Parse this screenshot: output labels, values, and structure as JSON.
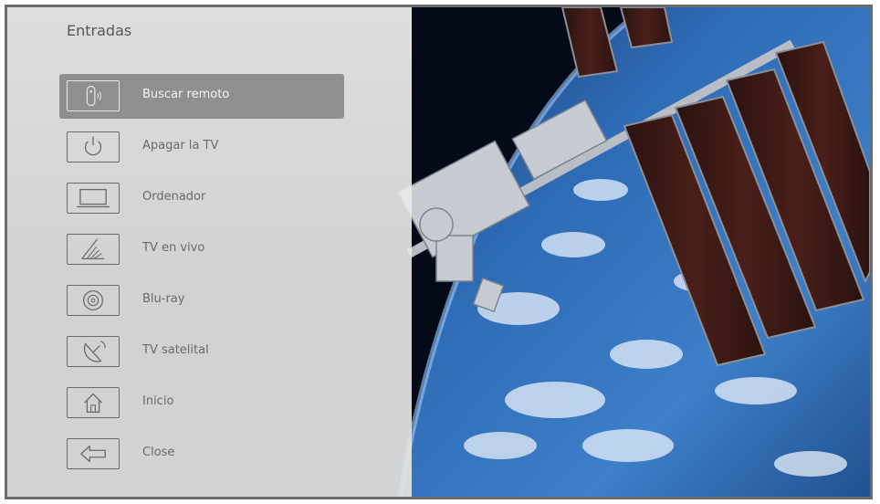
{
  "panel": {
    "title": "Entradas",
    "items": [
      {
        "label": "Buscar remoto",
        "icon": "remote-icon",
        "selected": true
      },
      {
        "label": "Apagar la TV",
        "icon": "power-icon",
        "selected": false
      },
      {
        "label": "Ordenador",
        "icon": "laptop-icon",
        "selected": false
      },
      {
        "label": "TV en vivo",
        "icon": "antenna-icon",
        "selected": false
      },
      {
        "label": "Blu-ray",
        "icon": "disc-icon",
        "selected": false
      },
      {
        "label": "TV satelital",
        "icon": "satellite-dish-icon",
        "selected": false
      },
      {
        "label": "Inicio",
        "icon": "home-icon",
        "selected": false
      },
      {
        "label": "Close",
        "icon": "back-arrow-icon",
        "selected": false
      }
    ]
  },
  "background": {
    "description_icon": "space-station-wallpaper"
  },
  "colors": {
    "panel_bg": "#ebebeb",
    "selected_bg": "#8f8f8f",
    "text": "#6a6a6a",
    "selected_text": "#f4f4f4"
  }
}
